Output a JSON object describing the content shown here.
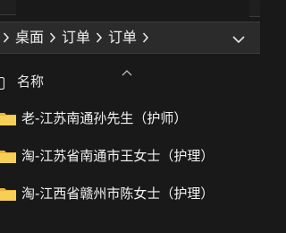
{
  "breadcrumb": {
    "items": [
      "桌面",
      "订单",
      "订单"
    ]
  },
  "columns": {
    "name": "名称"
  },
  "files": [
    {
      "name": "老-江苏南通孙先生（护师）",
      "type": "folder"
    },
    {
      "name": "淘-江苏省南通市王女士（护理）",
      "type": "folder"
    },
    {
      "name": "淘-江西省赣州市陈女士（护理）",
      "type": "folder"
    }
  ],
  "colors": {
    "background": "#191919",
    "address_bar": "#2b2b2b",
    "folder": "#f2c94c",
    "text": "#f2f2f2"
  }
}
